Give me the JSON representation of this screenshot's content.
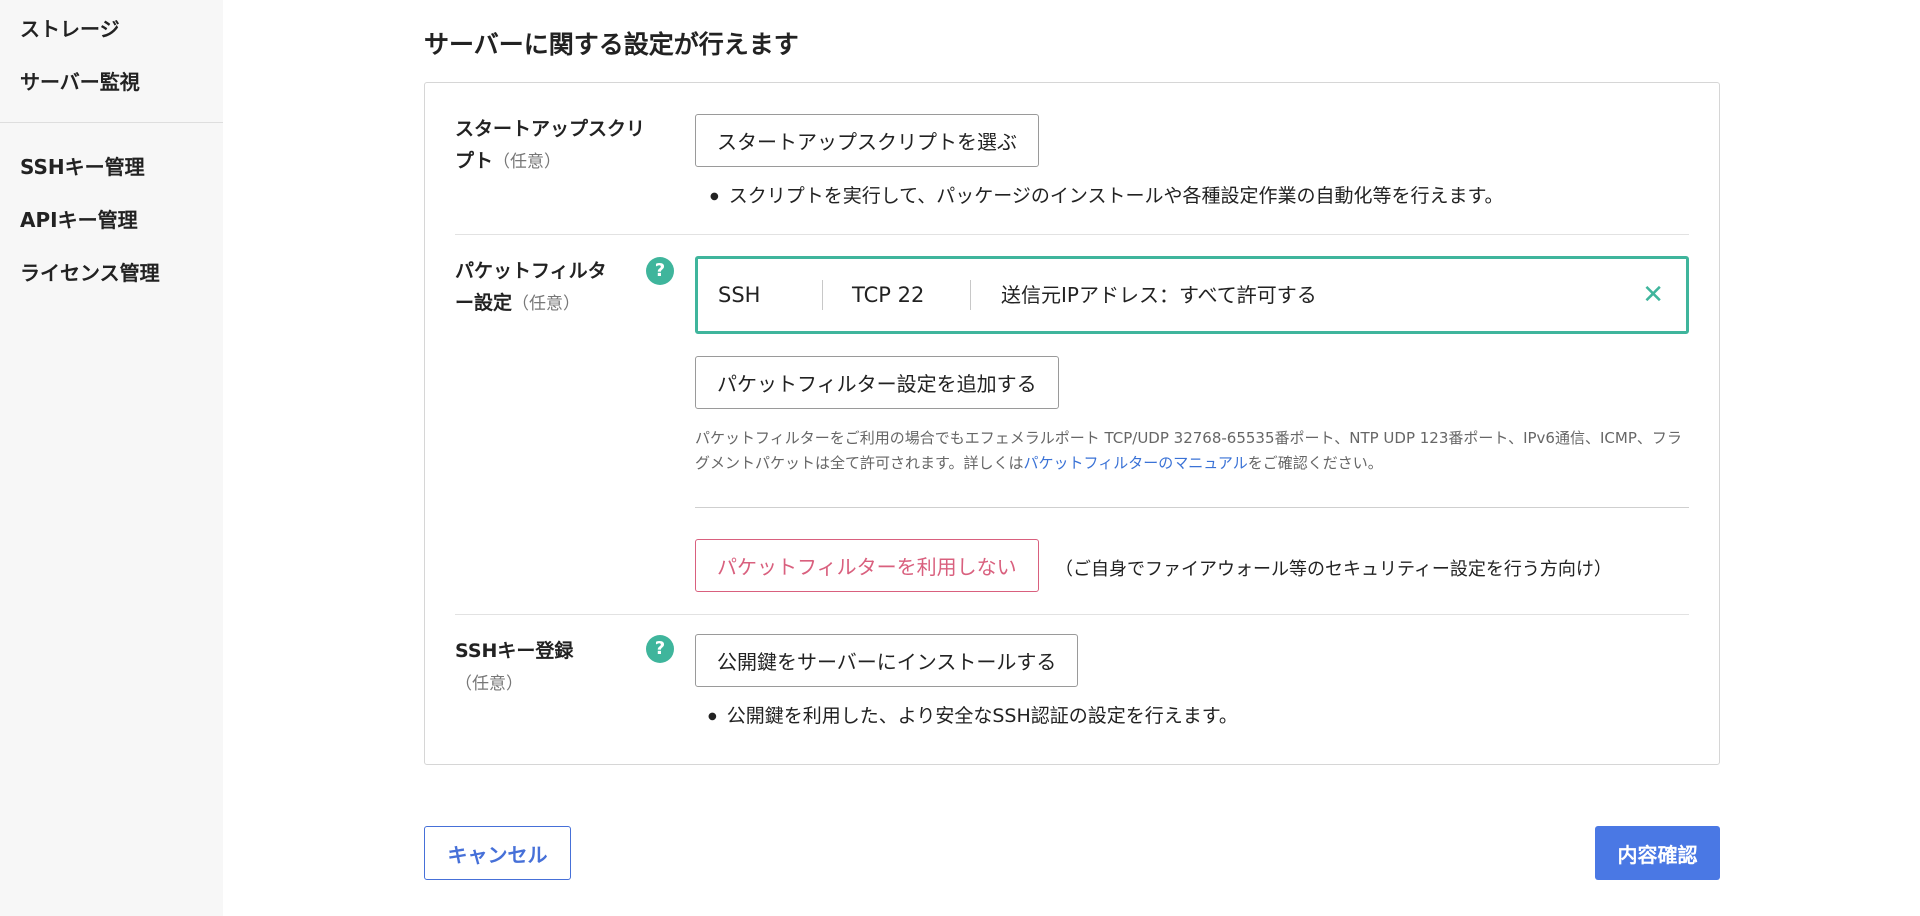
{
  "sidebar": {
    "items": [
      {
        "label": "ストレージ"
      },
      {
        "label": "サーバー監視"
      },
      {
        "label": "SSHキー管理"
      },
      {
        "label": "APIキー管理"
      },
      {
        "label": "ライセンス管理"
      }
    ]
  },
  "main": {
    "title": "サーバーに関する設定が行えます",
    "startup": {
      "label_line1": "スタートアップスクリ",
      "label_line2": "プト",
      "optional": "（任意）",
      "button": "スタートアップスクリプトを選ぶ",
      "bullet": "スクリプトを実行して、パッケージのインストールや各種設定作業の自動化等を行えます。"
    },
    "packet_filter": {
      "label_line1": "パケットフィルタ",
      "label_line2": "ー設定",
      "optional": "（任意）",
      "help_icon": "?",
      "rule": {
        "name": "SSH",
        "protocol": "TCP",
        "port": "22",
        "source": "送信元IPアドレス：すべて許可する",
        "close_icon": "✕"
      },
      "add_button": "パケットフィルター設定を追加する",
      "note_before_link": "パケットフィルターをご利用の場合でもエフェメラルポート TCP/UDP 32768-65535番ポート、NTP UDP 123番ポート、IPv6通信、ICMP、フラグメントパケットは全て許可されます。詳しくは",
      "note_link": "パケットフィルターのマニュアル",
      "note_after_link": "をご確認ください。",
      "disable_button": "パケットフィルターを利用しない",
      "disable_note": "（ご自身でファイアウォール等のセキュリティー設定を行う方向け）"
    },
    "ssh_key": {
      "label": "SSHキー登録",
      "optional": "（任意）",
      "help_icon": "?",
      "button": "公開鍵をサーバーにインストールする",
      "bullet": "公開鍵を利用した、より安全なSSH認証の設定を行えます。"
    }
  },
  "footer": {
    "cancel": "キャンセル",
    "confirm": "内容確認"
  },
  "colors": {
    "accent_green": "#3fb59c",
    "danger_pink": "#d9607e",
    "primary_blue": "#4a78e4"
  }
}
